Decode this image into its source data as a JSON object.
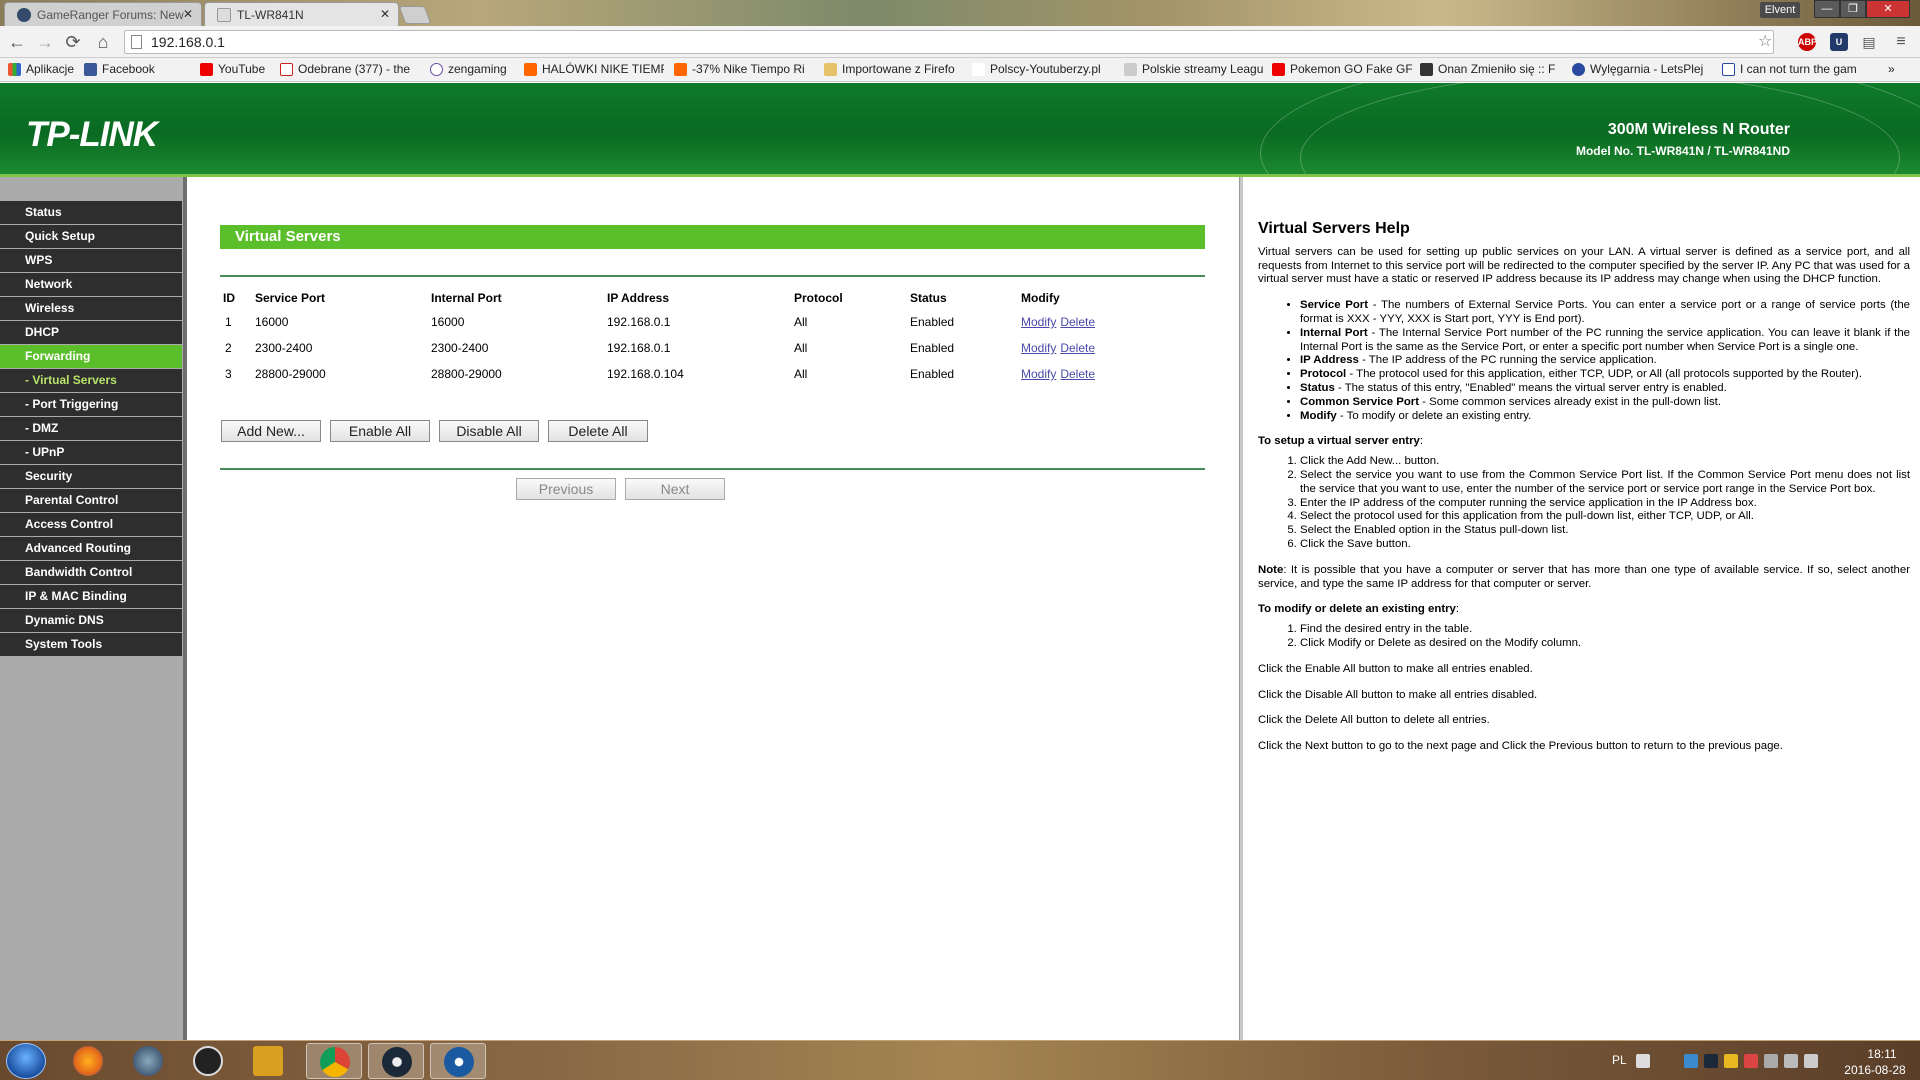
{
  "browser": {
    "tabs": [
      {
        "title": "GameRanger Forums: New",
        "active": false
      },
      {
        "title": "TL-WR841N",
        "active": true
      }
    ],
    "profile_name": "Elvent",
    "url": "192.168.0.1",
    "bookmarks": [
      {
        "label": "Aplikacje",
        "icon_color": "#e53"
      },
      {
        "label": "Facebook",
        "icon_color": "#3b5998"
      },
      {
        "label": "YouTube",
        "icon_color": "#e00"
      },
      {
        "label": "Odebrane (377) - the",
        "icon_color": "#c22"
      },
      {
        "label": "zengaming",
        "icon_color": "#6a4fa0"
      },
      {
        "label": "HALÓWKI NIKE TIEMP",
        "icon_color": "#f60"
      },
      {
        "label": "-37% Nike Tiempo Ri",
        "icon_color": "#f60"
      },
      {
        "label": "Importowane z Firefo",
        "icon_color": "#e6c36a"
      },
      {
        "label": "Polscy-Youtuberzy.pl",
        "icon_color": "#c22"
      },
      {
        "label": "Polskie streamy Leagu",
        "icon_color": "#888"
      },
      {
        "label": "Pokemon GO Fake GF",
        "icon_color": "#e00"
      },
      {
        "label": "Onan Zmieniło się :: F",
        "icon_color": "#333"
      },
      {
        "label": "Wylęgarnia - LetsPlej",
        "icon_color": "#2a4aa0"
      },
      {
        "label": "I can not turn the gam",
        "icon_color": "#2a4aa0"
      }
    ],
    "extensions": [
      {
        "name": "adblock-plus-icon",
        "label": "ABP",
        "color": "#c00"
      },
      {
        "name": "ublock-icon",
        "label": "U",
        "color": "#223a6a"
      }
    ]
  },
  "router": {
    "logo": "TP-LINK",
    "product_name": "300M Wireless N Router",
    "model": "Model No. TL-WR841N / TL-WR841ND"
  },
  "menu": [
    {
      "label": "Status",
      "type": "main"
    },
    {
      "label": "Quick Setup",
      "type": "main"
    },
    {
      "label": "WPS",
      "type": "main"
    },
    {
      "label": "Network",
      "type": "main"
    },
    {
      "label": "Wireless",
      "type": "main"
    },
    {
      "label": "DHCP",
      "type": "main"
    },
    {
      "label": "Forwarding",
      "type": "active"
    },
    {
      "label": "- Virtual Servers",
      "type": "subactive"
    },
    {
      "label": "- Port Triggering",
      "type": "sub"
    },
    {
      "label": "- DMZ",
      "type": "sub"
    },
    {
      "label": "- UPnP",
      "type": "sub"
    },
    {
      "label": "Security",
      "type": "main"
    },
    {
      "label": "Parental Control",
      "type": "main"
    },
    {
      "label": "Access Control",
      "type": "main"
    },
    {
      "label": "Advanced Routing",
      "type": "main"
    },
    {
      "label": "Bandwidth Control",
      "type": "main"
    },
    {
      "label": "IP & MAC Binding",
      "type": "main"
    },
    {
      "label": "Dynamic DNS",
      "type": "main"
    },
    {
      "label": "System Tools",
      "type": "main"
    }
  ],
  "main": {
    "title": "Virtual Servers",
    "columns": [
      "ID",
      "Service Port",
      "Internal Port",
      "IP Address",
      "Protocol",
      "Status",
      "Modify"
    ],
    "rows": [
      {
        "id": "1",
        "service_port": "16000",
        "internal_port": "16000",
        "ip": "192.168.0.1",
        "protocol": "All",
        "status": "Enabled",
        "modify": "Modify",
        "delete": "Delete"
      },
      {
        "id": "2",
        "service_port": "2300-2400",
        "internal_port": "2300-2400",
        "ip": "192.168.0.1",
        "protocol": "All",
        "status": "Enabled",
        "modify": "Modify",
        "delete": "Delete"
      },
      {
        "id": "3",
        "service_port": "28800-29000",
        "internal_port": "28800-29000",
        "ip": "192.168.0.104",
        "protocol": "All",
        "status": "Enabled",
        "modify": "Modify",
        "delete": "Delete"
      }
    ],
    "buttons": {
      "add_new": "Add New...",
      "enable_all": "Enable All",
      "disable_all": "Disable All",
      "delete_all": "Delete All",
      "previous": "Previous",
      "next": "Next"
    }
  },
  "help": {
    "title": "Virtual Servers Help",
    "intro": "Virtual servers can be used for setting up public services on your LAN. A virtual server is defined as a service port, and all requests from Internet to this service port will be redirected to the computer specified by the server IP. Any PC that was used for a virtual server must have a static or reserved IP address because its IP address may change when using the DHCP function.",
    "fields": [
      {
        "term": "Service Port",
        "text": " - The numbers of External Service Ports. You can enter a service port or a range of service ports (the format is XXX - YYY, XXX is Start port, YYY is End port)."
      },
      {
        "term": "Internal Port",
        "text": " - The Internal Service Port number of the PC running the service application. You can leave it blank if the Internal Port is the same as the Service Port, or enter a specific port number when Service Port is a single one."
      },
      {
        "term": "IP Address",
        "text": " - The IP address of the PC running the service application."
      },
      {
        "term": "Protocol",
        "text": " - The protocol used for this application, either TCP, UDP, or All (all protocols supported by the Router)."
      },
      {
        "term": "Status",
        "text": " - The status of this entry, \"Enabled\" means the virtual server entry is enabled."
      },
      {
        "term": "Common Service Port",
        "text": " - Some common services already exist in the pull-down list."
      },
      {
        "term": "Modify",
        "text": " - To modify or delete an existing entry."
      }
    ],
    "setup_heading": "To setup a virtual server entry",
    "setup_steps": [
      "Click the Add New... button.",
      "Select the service you want to use from the Common Service Port list. If the Common Service Port menu does not list the service that you want to use, enter the number of the service port or service port range in the Service Port box.",
      "Enter the IP address of the computer running the service application in the IP Address box.",
      "Select the protocol used for this application from the pull-down list, either TCP, UDP, or All.",
      "Select the Enabled option in the Status pull-down list.",
      "Click the Save button."
    ],
    "note_label": "Note",
    "note": ": It is possible that you have a computer or server that has more than one type of available service. If so, select another service, and type the same IP address for that computer or server.",
    "modify_heading": "To modify or delete an existing entry",
    "modify_steps": [
      "Find the desired entry in the table.",
      "Click Modify or Delete as desired on the Modify column."
    ],
    "lines": [
      "Click the Enable All button to make all entries enabled.",
      "Click the Disable All button to make all entries disabled.",
      "Click the Delete All button to delete all entries.",
      "Click the Next button to go to the next page and Click the Previous button to return to the previous page."
    ]
  },
  "taskbar": {
    "apps": [
      {
        "name": "firefox",
        "color": "#e66a1a"
      },
      {
        "name": "teamspeak",
        "color": "#2a3a5a"
      },
      {
        "name": "obs",
        "color": "#222"
      },
      {
        "name": "pen-tool",
        "color": "#d9a020"
      },
      {
        "name": "chrome",
        "color": "#e8b820"
      },
      {
        "name": "steam",
        "color": "#1b2838"
      },
      {
        "name": "gameranger",
        "color": "#1a5aa0"
      }
    ],
    "language": "PL",
    "time": "18:11",
    "date": "2016-08-28"
  }
}
